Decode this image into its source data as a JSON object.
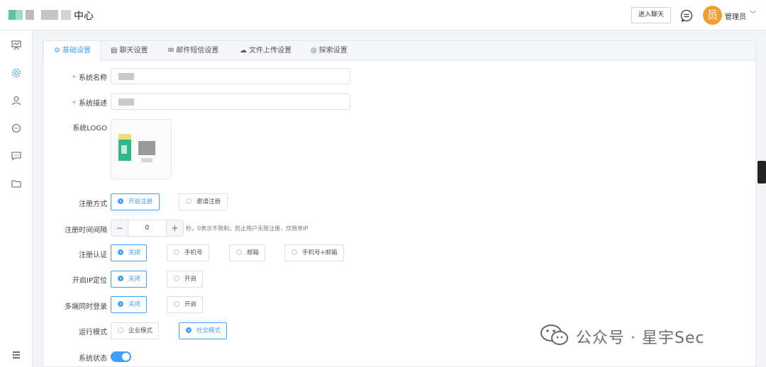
{
  "header": {
    "title_suffix": "中心",
    "chat_button": "进入聊天",
    "avatar_char": "员",
    "user_name": "管理员",
    "caret": "﹀"
  },
  "tabs": [
    {
      "label": "基础设置",
      "icon": "gear-icon",
      "active": true
    },
    {
      "label": "聊天设置",
      "icon": "chat-list-icon",
      "active": false
    },
    {
      "label": "邮件短信设置",
      "icon": "mail-icon",
      "active": false
    },
    {
      "label": "文件上传设置",
      "icon": "cloud-upload-icon",
      "active": false
    },
    {
      "label": "探索设置",
      "icon": "compass-icon",
      "active": false
    }
  ],
  "form": {
    "system_name_label": "系统名称",
    "system_desc_label": "系统描述",
    "logo_label": "系统LOGO",
    "register_mode": {
      "label": "注册方式",
      "options": [
        "开启注册",
        "邀请注册"
      ],
      "selected": "开启注册"
    },
    "register_interval": {
      "label": "注册时间间隔",
      "value": "0",
      "minus": "−",
      "plus": "+",
      "hint": "秒，0表示不限制，防止用户无限注册，仅限单IP"
    },
    "register_auth": {
      "label": "注册认证",
      "options": [
        "关闭",
        "手机号",
        "邮箱",
        "手机号+邮箱"
      ],
      "selected": "关闭"
    },
    "ip_location": {
      "label": "开启IP定位",
      "options": [
        "关闭",
        "开启"
      ],
      "selected": "关闭"
    },
    "multi_login": {
      "label": "多端同时登录",
      "options": [
        "关闭",
        "开启"
      ],
      "selected": "关闭"
    },
    "run_mode": {
      "label": "运行模式",
      "options": [
        "企业模式",
        "社交模式"
      ],
      "selected": "社交模式"
    },
    "system_status": {
      "label": "系统状态",
      "enabled": true
    }
  },
  "watermark": "公众号 · 星宇Sec",
  "colors": {
    "accent": "#409eff",
    "avatar": "#f0a030",
    "required": "#f56c6c"
  }
}
